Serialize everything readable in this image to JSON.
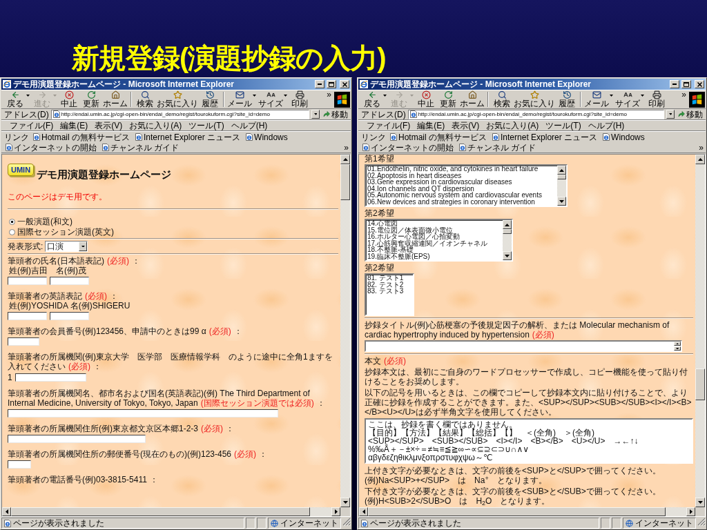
{
  "slide": {
    "title": "新規登録(演題抄録の入力)"
  },
  "windows": [
    {
      "title": "デモ用演題登録ホームページ - Microsoft Internet Explorer",
      "toolbar": [
        {
          "buttons": [
            {
              "kind": "back",
              "label": "戻る",
              "disabled": false,
              "dropdown": true
            },
            {
              "kind": "forward",
              "label": "進む",
              "disabled": true,
              "dropdown": true
            },
            {
              "kind": "stop",
              "label": "中止",
              "disabled": false,
              "dropdown": false
            },
            {
              "kind": "refresh",
              "label": "更新",
              "disabled": false,
              "dropdown": false
            },
            {
              "kind": "home",
              "label": "ホーム",
              "disabled": false,
              "dropdown": false
            }
          ]
        },
        {
          "buttons": [
            {
              "kind": "search",
              "label": "検索",
              "disabled": false,
              "dropdown": false
            },
            {
              "kind": "favorites",
              "label": "お気に入り",
              "disabled": false,
              "dropdown": false
            },
            {
              "kind": "history",
              "label": "履歴",
              "disabled": false,
              "dropdown": false
            }
          ]
        },
        {
          "buttons": [
            {
              "kind": "mail",
              "label": "メール",
              "disabled": false,
              "dropdown": true
            },
            {
              "kind": "size",
              "label": "サイズ",
              "disabled": false,
              "dropdown": true
            },
            {
              "kind": "print",
              "label": "印刷",
              "disabled": false,
              "dropdown": false
            }
          ]
        }
      ],
      "toolbar_more": "»",
      "address": {
        "label": "アドレス(D)",
        "url": "http://endai.umin.ac.jp/cgi-open-bin/endai_demo/regist/tourokuform.cgi?site_id=demo",
        "go": "移動"
      },
      "menu": [
        "ファイル(F)",
        "編集(E)",
        "表示(V)",
        "お気に入り(A)",
        "ツール(T)",
        "ヘルプ(H)"
      ],
      "links": {
        "label": "リンク",
        "items": [
          "Hotmail の無料サービス",
          "Internet Explorer ニュース",
          "Windows",
          "インターネットの開始",
          "チャンネル ガイド"
        ],
        "more": "»"
      },
      "scrolled": false,
      "content": [
        {
          "kind": "banner",
          "logo": "UMIN",
          "title": "デモ用演題登録ホームページ"
        },
        {
          "kind": "notice",
          "text": "このページはデモ用です。"
        },
        {
          "kind": "rule"
        },
        {
          "kind": "radios",
          "options": [
            {
              "label": "一般演題(和文)",
              "selected": true
            },
            {
              "label": "国際セッション演題(英文)",
              "selected": false
            }
          ]
        },
        {
          "kind": "rule"
        },
        {
          "kind": "select",
          "label": "発表形式:",
          "value": "口演"
        },
        {
          "kind": "rule"
        },
        {
          "kind": "field",
          "label": "筆頭者の氏名(日本語表記)",
          "note": "(必須)",
          "colon": "：",
          "hint": "姓(例)吉田　名(例)茂",
          "inputs": [
            {
              "kind": "short"
            },
            {
              "kind": "short"
            }
          ]
        },
        {
          "kind": "field",
          "label": "筆頭著者の英語表記",
          "note": "(必須)",
          "colon": "：",
          "hint": "姓(例)YOSHIDA 名(例)SHIGERU",
          "inputs": [
            {
              "kind": "short"
            },
            {
              "kind": "short"
            }
          ]
        },
        {
          "kind": "field",
          "label": "筆頭著者の会員番号(例)123456、申請中のときは99 α",
          "note": "(必須)",
          "colon": "：",
          "inputs": [
            {
              "kind": "small"
            }
          ]
        },
        {
          "kind": "field",
          "label": "筆頭著者の所属機関(例)東京大学　医学部　医療情報学科　のように途中に全角1ますを入れてください",
          "note": "(必須)",
          "colon": "：",
          "inputs": [
            {
              "kind": "medium",
              "prefix": "1"
            }
          ]
        },
        {
          "kind": "field",
          "label": "筆頭著者の所属機関名、都市名および国名(英語表記)(例) The Third Department of Internal Medicine, University of Tokyo, Tokyo, Japan",
          "note": "(国際セッション演題では必須)",
          "colon": "：",
          "inputs": [
            {
              "kind": "full"
            }
          ]
        },
        {
          "kind": "field",
          "label": "筆頭著者の所属機関住所(例)東京都文京区本郷1-2-3",
          "note": "(必須)",
          "colon": "：",
          "inputs": [
            {
              "kind": "long"
            }
          ]
        },
        {
          "kind": "field",
          "label": "筆頭著者の所属機関住所の郵便番号(現在のもの)(例)123-456",
          "note": "(必須)",
          "colon": "：",
          "inputs": [
            {
              "kind": "tiny"
            }
          ]
        },
        {
          "kind": "field",
          "label": "筆頭著者の電話番号(例)03-3815-5411",
          "colon": "："
        }
      ],
      "status": {
        "text": "ページが表示されました",
        "zone": "インターネット"
      }
    },
    {
      "title": "デモ用演題登録ホームページ - Microsoft Internet Explorer",
      "toolbar": [
        {
          "buttons": [
            {
              "kind": "back",
              "label": "戻る",
              "disabled": false,
              "dropdown": true
            },
            {
              "kind": "forward",
              "label": "進む",
              "disabled": true,
              "dropdown": true
            },
            {
              "kind": "stop",
              "label": "中止",
              "disabled": false,
              "dropdown": false
            },
            {
              "kind": "refresh",
              "label": "更新",
              "disabled": false,
              "dropdown": false
            },
            {
              "kind": "home",
              "label": "ホーム",
              "disabled": false,
              "dropdown": false
            }
          ]
        },
        {
          "buttons": [
            {
              "kind": "search",
              "label": "検索",
              "disabled": false,
              "dropdown": false
            },
            {
              "kind": "favorites",
              "label": "お気に入り",
              "disabled": false,
              "dropdown": false
            },
            {
              "kind": "history",
              "label": "履歴",
              "disabled": false,
              "dropdown": false
            }
          ]
        },
        {
          "buttons": [
            {
              "kind": "mail",
              "label": "メール",
              "disabled": false,
              "dropdown": true
            },
            {
              "kind": "size",
              "label": "サイズ",
              "disabled": false,
              "dropdown": true
            },
            {
              "kind": "print",
              "label": "印刷",
              "disabled": false,
              "dropdown": false
            }
          ]
        }
      ],
      "toolbar_more": "»",
      "address": {
        "label": "アドレス(D)",
        "url": "http://endai.umin.ac.jp/cgi-open-bin/endai_demo/regist/tourokuform.cgi?site_id=demo",
        "go": "移動"
      },
      "menu": [
        "ファイル(F)",
        "編集(E)",
        "表示(V)",
        "お気に入り(A)",
        "ツール(T)",
        "ヘルプ(H)"
      ],
      "links": {
        "label": "リンク",
        "items": [
          "Hotmail の無料サービス",
          "Internet Explorer ニュース",
          "Windows",
          "インターネットの開始",
          "チャンネル ガイド"
        ],
        "more": "»"
      },
      "scrolled": true,
      "content": [
        {
          "kind": "listbox",
          "label": "第1希望",
          "scrollbar": true,
          "options": [
            "01.Endothelin, nitric oxide, and cytokines in heart failure",
            "02.Apoptosis in heart diseases",
            "03.Gene expression in cardiovascular diseases",
            "04.Ion channels and QT dispersion",
            "05.Autonomic nervous system and cardiovascular events",
            "06.New devices and strategies in coronary intervention"
          ]
        },
        {
          "kind": "listbox",
          "label": "第2希望",
          "scrollbar": true,
          "options": [
            "14.心電図",
            "15.電位図／体表面微小電位",
            "16.ホルター心電図／心拍変動",
            "17.心筋興奮収縮連関／イオンチャネル",
            "18.不整脈-基礎",
            "19.臨床不整脈(EPS)"
          ]
        },
        {
          "kind": "listbox",
          "label": "第2希望",
          "scrollbar": false,
          "options": [
            "81. テスト1",
            "82. テスト2",
            "83. テスト3"
          ]
        },
        {
          "kind": "rule"
        },
        {
          "kind": "title_field",
          "label": "抄録タイトル(例)心筋梗塞の予後規定因子の解析、または Molecular mechanism of cardiac hypertrophy induced by hypertension",
          "note": "(必須)"
        },
        {
          "kind": "rule"
        },
        {
          "kind": "heading",
          "text": "本文",
          "note": "(必須)"
        },
        {
          "kind": "paragraph",
          "lines": [
            "抄録本文は、最初にご自身のワードプロセッサーで作成し、コピー機能を使って貼り付けることをお奨めします。"
          ]
        },
        {
          "kind": "paragraph",
          "lines": [
            "以下の記号を用いるときは、この欄でコピーして抄録本文内に貼り付けることで、より正確に抄録を作成することができます。また、<SUP></SUP><SUB></SUB><I></I><B></B><U></U>は必ず半角文字を使用してください。"
          ]
        },
        {
          "kind": "symbols",
          "lines": [
            "ここは、抄録を書く欄ではありません。",
            "【目的】【方法】【結果】【総括】【】　＜(全角)　＞(全角)",
            "<SUP></SUP>　<SUB></SUB>　<I></I>　<B></B>　<U></U>　→←↑↓",
            "%‰Å＋－±×÷＝≠≒≡≦≧∞∽∝⊆⊇⊂⊃∪∩∧∨",
            "αβγδεζηθικλμνξοπρστυφχψω～℃"
          ]
        },
        {
          "kind": "paragraph",
          "lines": [
            "上付き文字が必要なときは、文字の前後を<SUP>と</SUP>で囲ってください。",
            "(例)Na<SUP>+</SUP>　は　Na$^{+}$　となります。"
          ]
        },
        {
          "kind": "paragraph",
          "lines": [
            "下付き文字が必要なときは、文字の前後を<SUB>と</SUB>で囲ってください。",
            "(例)H<SUB>2</SUB>O　は　H$_{2}$O　となります。"
          ]
        }
      ],
      "status": {
        "text": "ページが表示されました",
        "zone": "インターネット"
      }
    }
  ]
}
